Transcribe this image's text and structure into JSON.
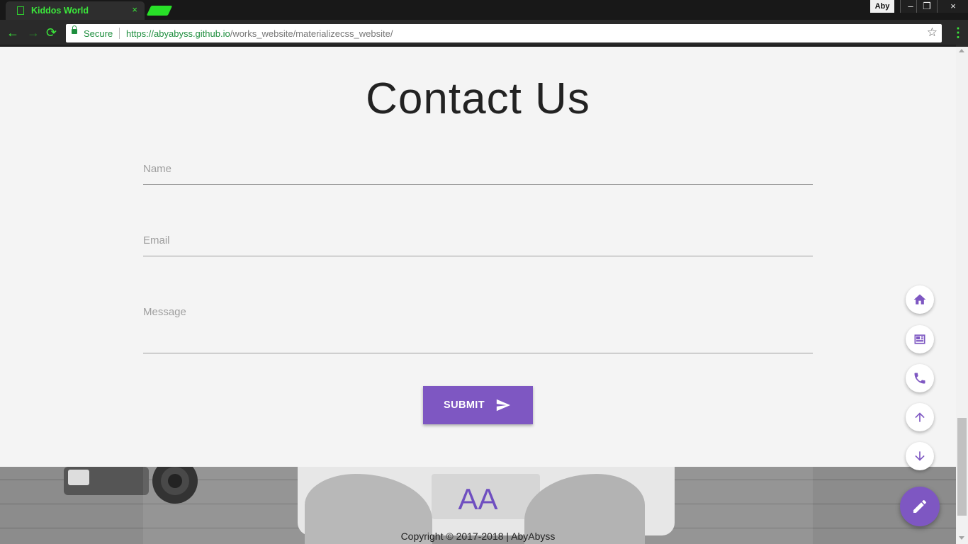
{
  "browser": {
    "tab_title": "Kiddos World",
    "tab_close": "×",
    "profile_name": "Aby",
    "window_minimize": "–",
    "window_restore": "❐",
    "window_close": "×",
    "back_glyph": "←",
    "forward_glyph": "→",
    "reload_glyph": "⟳",
    "secure_label": "Secure",
    "url_host": "https://abyabyss.github.io",
    "url_path": "/works_website/materializecss_website/",
    "star_glyph": "☆",
    "menu_glyph": "⋮"
  },
  "contact": {
    "title": "Contact Us",
    "name_label": "Name",
    "email_label": "Email",
    "message_label": "Message",
    "submit_label": "SUBMIT"
  },
  "footer": {
    "logo_text": "AA",
    "copyright": "Copyright © 2017-2018 | AbyAbyss"
  },
  "fab_buttons": [
    {
      "icon": "home-icon"
    },
    {
      "icon": "newspaper-icon"
    },
    {
      "icon": "phone-icon"
    },
    {
      "icon": "arrow-up-icon"
    },
    {
      "icon": "arrow-down-icon"
    }
  ],
  "fab_main_icon": "pencil-icon",
  "colors": {
    "accent": "#7e57c2",
    "browser_accent": "#3be83b",
    "secure": "#1e8e3e",
    "page_background": "#f4f4f4"
  }
}
